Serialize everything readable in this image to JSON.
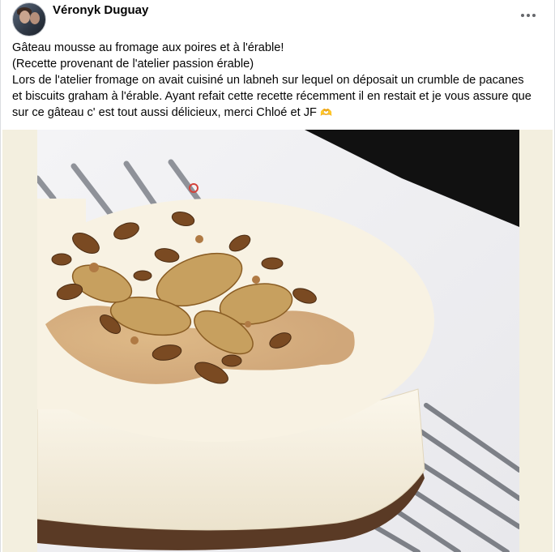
{
  "post": {
    "author": "Véronyk Duguay",
    "more_icon": "more-horizontal-icon",
    "text_lines": [
      "Gâteau mousse au fromage aux poires et à l'érable!",
      "(Recette provenant de l'atelier passion érable)",
      "Lors de l'atelier fromage on avait cuisiné un labneh sur lequel on déposait un crumble de pacanes",
      "et biscuits graham à l'érable. Ayant refait cette recette récemment il en restait et je vous assure que",
      "sur ce gâteau c' est tout aussi délicieux, merci Chloé et JF"
    ],
    "emoji_icon": "praying-hands-emoji",
    "emoji": "🫶",
    "photo_subject": "cheesecake-with-pears-and-pecans"
  },
  "colors": {
    "background": "#ffffff",
    "name": "#050505",
    "icon_gray": "#65676b",
    "photo_margin": "#f3efdf"
  }
}
